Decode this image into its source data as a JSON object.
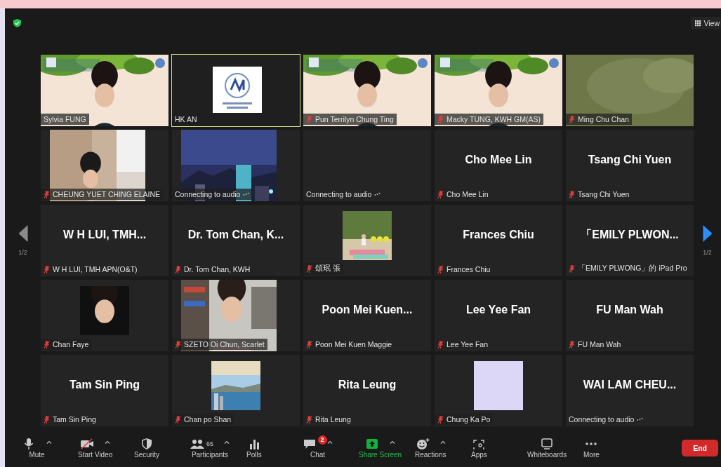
{
  "top_bar": {
    "view_label": "View"
  },
  "pager": {
    "prev": {
      "disabled": true,
      "page": "1/2"
    },
    "next": {
      "disabled": false,
      "page": "1/2"
    }
  },
  "tiles": [
    {
      "kind": "video",
      "label": "Sylvia FUNG",
      "muted": false,
      "connecting": false,
      "selected": false
    },
    {
      "kind": "video",
      "label": "HK AN",
      "muted": false,
      "connecting": false,
      "selected": true
    },
    {
      "kind": "video",
      "label": "Pun Terrilyn Chung Ting",
      "muted": true,
      "connecting": false,
      "selected": false
    },
    {
      "kind": "video",
      "label": "Macky TUNG, KWH GM(AS)",
      "muted": true,
      "connecting": false,
      "selected": false
    },
    {
      "kind": "video",
      "label": "Ming Chu Chan",
      "muted": true,
      "connecting": false,
      "selected": false
    },
    {
      "kind": "camera",
      "label": "CHEUNG YUET CHING ELAINE",
      "muted": true,
      "connecting": false,
      "selected": false
    },
    {
      "kind": "camera",
      "label": "Connecting to audio",
      "muted": false,
      "connecting": true,
      "selected": false
    },
    {
      "kind": "empty",
      "label": "Connecting to audio",
      "muted": false,
      "connecting": true,
      "selected": false
    },
    {
      "kind": "name",
      "display_name": "Cho Mee Lin",
      "label": "Cho Mee Lin",
      "muted": true,
      "connecting": false,
      "selected": false
    },
    {
      "kind": "name",
      "display_name": "Tsang Chi Yuen",
      "label": "Tsang Chi Yuen",
      "muted": true,
      "connecting": false,
      "selected": false
    },
    {
      "kind": "name",
      "display_name": "W H LUI, TMH...",
      "label": "W H LUI, TMH APN(O&T)",
      "muted": true,
      "connecting": false,
      "selected": false
    },
    {
      "kind": "name",
      "display_name": "Dr. Tom Chan, K...",
      "label": "Dr. Tom Chan, KWH",
      "muted": true,
      "connecting": false,
      "selected": false
    },
    {
      "label": "頌珉 張",
      "muted": true,
      "connecting": false,
      "selected": false
    },
    {
      "kind": "name",
      "display_name": "Frances Chiu",
      "label": "Frances Chiu",
      "muted": true,
      "connecting": false,
      "selected": false
    },
    {
      "kind": "name",
      "display_name": "「EMILY PLWON...",
      "label": "「EMILY PLWONG」的 iPad Pro",
      "muted": true,
      "connecting": false,
      "selected": false
    },
    {
      "label": "Chan Faye",
      "muted": true,
      "connecting": false,
      "selected": false
    },
    {
      "kind": "camera",
      "label": "SZETO Oi Chun, Scarlet",
      "muted": true,
      "connecting": false,
      "selected": false
    },
    {
      "kind": "name",
      "display_name": "Poon Mei Kuen...",
      "label": "Poon Mei Kuen Maggie",
      "muted": true,
      "connecting": false,
      "selected": false
    },
    {
      "kind": "name",
      "display_name": "Lee Yee Fan",
      "label": "Lee Yee Fan",
      "muted": true,
      "connecting": false,
      "selected": false
    },
    {
      "kind": "name",
      "display_name": "FU Man Wah",
      "label": "FU Man Wah",
      "muted": true,
      "connecting": false,
      "selected": false
    },
    {
      "kind": "name",
      "display_name": "Tam Sin Ping",
      "label": "Tam Sin Ping",
      "muted": true,
      "connecting": false,
      "selected": false
    },
    {
      "label": "Chan po Shan",
      "muted": true,
      "connecting": false,
      "selected": false
    },
    {
      "kind": "name",
      "display_name": "Rita Leung",
      "label": "Rita Leung",
      "muted": true,
      "connecting": false,
      "selected": false
    },
    {
      "label": "Chung Ka Po",
      "muted": true,
      "connecting": false,
      "selected": false
    },
    {
      "kind": "name",
      "display_name": "WAI LAM CHEU...",
      "label": "Connecting to audio",
      "muted": false,
      "connecting": true,
      "selected": false
    }
  ],
  "toolbar": {
    "items": [
      {
        "kind": "mute",
        "label": "Mute",
        "caret": true
      },
      {
        "kind": "video-off",
        "label": "Start Video",
        "caret": true
      },
      {
        "kind": "security",
        "label": "Security",
        "caret": false
      },
      {
        "kind": "participants",
        "label": "Participants",
        "count": "65",
        "caret": true
      },
      {
        "kind": "polls",
        "label": "Polls",
        "caret": false
      },
      {
        "kind": "chat",
        "label": "Chat",
        "badge": "2",
        "caret": true
      },
      {
        "kind": "share",
        "label": "Share Screen",
        "caret": true
      },
      {
        "kind": "reactions",
        "label": "Reactions",
        "caret": true
      },
      {
        "kind": "apps",
        "label": "Apps",
        "caret": false
      },
      {
        "kind": "whiteboards",
        "label": "Whiteboards",
        "caret": false
      },
      {
        "kind": "more",
        "label": "More",
        "caret": false
      }
    ],
    "end_label": "End"
  }
}
